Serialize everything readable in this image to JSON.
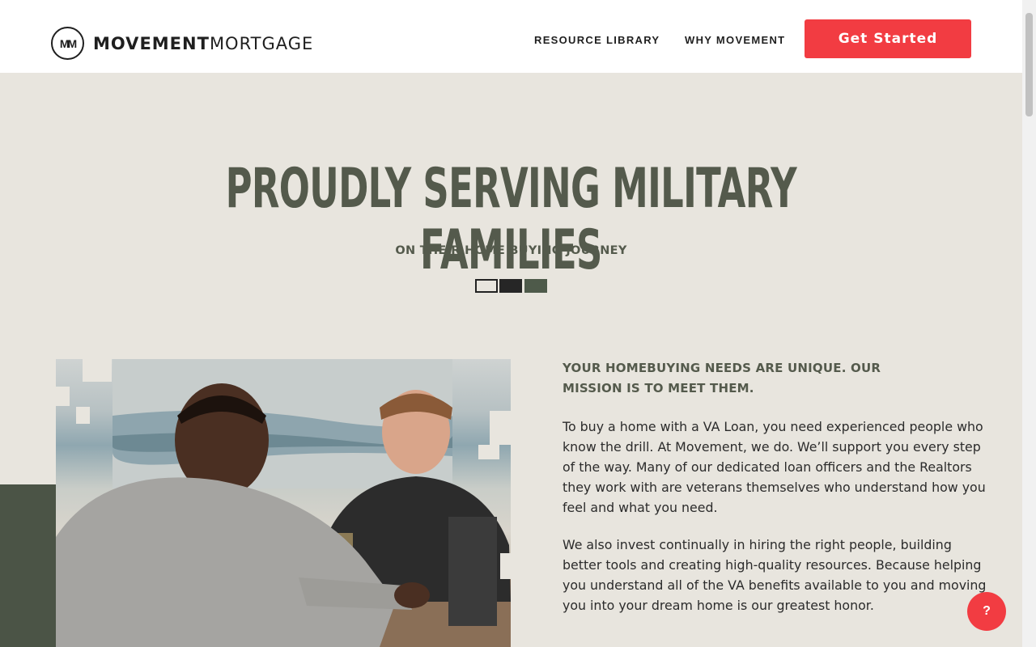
{
  "header": {
    "logo_mark": "MM",
    "logo_bold": "MOVEMENT",
    "logo_light": "MORTGAGE",
    "nav": {
      "resources": "RESOURCE LIBRARY",
      "why": "WHY MOVEMENT"
    },
    "cta_label": "Get Started"
  },
  "hero": {
    "title": "PROUDLY SERVING MILITARY FAMILIES",
    "subtitle": "ON THEIR HOME BUYING JOURNEY"
  },
  "content": {
    "heading": "YOUR HOMEBUYING NEEDS ARE UNIQUE. OUR MISSION IS TO MEET THEM.",
    "paragraph_1": "To buy a home with a VA Loan, you need experienced people who know the drill. At Movement, we do. We’ll support you every step of the way. Many of our dedicated loan officers and the Realtors they work with are veterans themselves who understand how you feel and what you need.",
    "paragraph_2": "We also invest continually in hiring the right people, building better tools and creating high-quality resources. Because helping you understand all of the VA benefits available to you and moving you into your dream home is our greatest honor."
  },
  "help_button": "?",
  "colors": {
    "accent": "#f23c42",
    "olive": "#545a4c",
    "background": "#e8e5de"
  },
  "icons": [
    "logo-mark-icon",
    "flag-icon"
  ]
}
